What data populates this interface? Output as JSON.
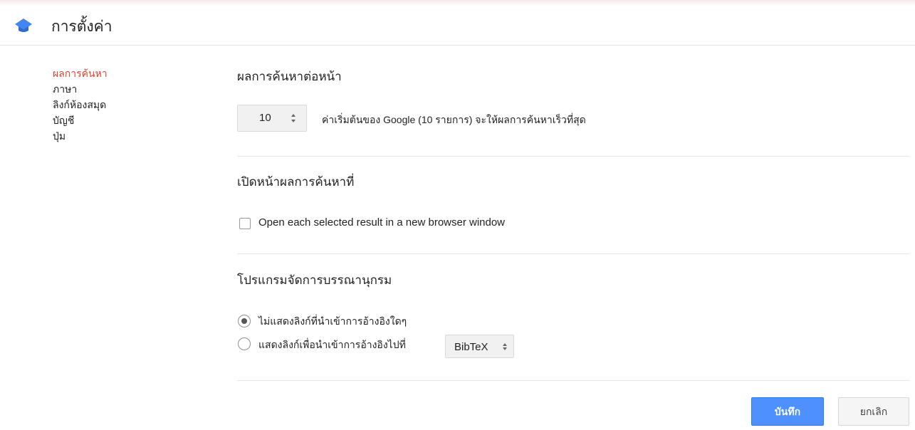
{
  "header": {
    "title": "การตั้งค่า",
    "logo_icon": "scholar-cap-icon"
  },
  "sidebar": {
    "items": [
      {
        "label": "ผลการค้นหา",
        "active": true
      },
      {
        "label": "ภาษา",
        "active": false
      },
      {
        "label": "ลิงก์ห้องสมุด",
        "active": false
      },
      {
        "label": "บัญชี",
        "active": false
      },
      {
        "label": "ปุ่ม",
        "active": false
      }
    ]
  },
  "results_per_page": {
    "title": "ผลการค้นหาต่อหน้า",
    "value": "10",
    "note": "ค่าเริ่มต้นของ Google (10 รายการ) จะให้ผลการค้นหาเร็วที่สุด"
  },
  "open_results": {
    "title": "เปิดหน้าผลการค้นหาที่",
    "checkbox_label": "Open each selected result in a new browser window",
    "checked": false
  },
  "bibliography": {
    "title": "โปรแกรมจัดการบรรณานุกรม",
    "option_none": "ไม่แสดงลิงก์ที่นำเข้าการอ้างอิงใดๆ",
    "option_show": "แสดงลิงก์เพื่อนำเข้าการอ้างอิงไปที่",
    "selected_format": "BibTeX",
    "selected_option": "none"
  },
  "buttons": {
    "save": "บันทึก",
    "cancel": "ยกเลิก"
  },
  "colors": {
    "active_link": "#d14836",
    "primary_button": "#4d90fe",
    "logo": "#4285f4"
  }
}
